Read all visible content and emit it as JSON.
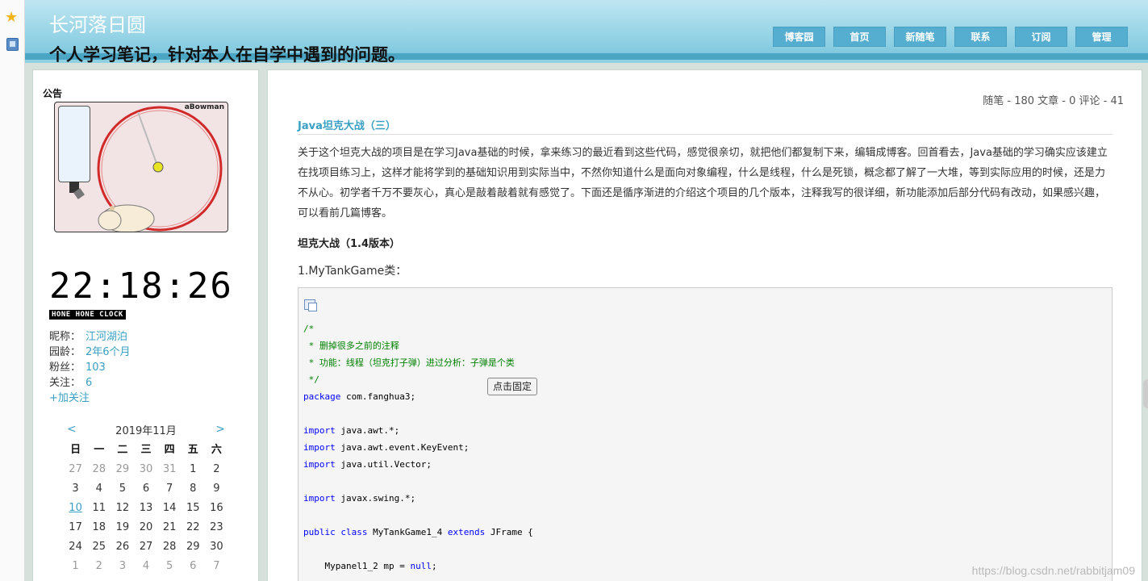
{
  "header": {
    "title": "长河落日圆",
    "subtitle": "个人学习笔记，针对本人在自学中遇到的问题。",
    "nav": [
      "博客园",
      "首页",
      "新随笔",
      "联系",
      "订阅",
      "管理"
    ]
  },
  "sidebar": {
    "notice_title": "公告",
    "hamster_brand": "aBowman",
    "clock_time": "22:18:26",
    "clock_label": "HONE HONE CLOCK",
    "profile": {
      "nickname_label": "昵称：",
      "nickname": "江河湖泊",
      "age_label": "园龄：",
      "age": "2年6个月",
      "fans_label": "粉丝：",
      "fans": "103",
      "follow_label": "关注：",
      "follow": "6",
      "add_follow": "+加关注"
    },
    "calendar": {
      "prev": "<",
      "next": ">",
      "month": "2019年11月",
      "weekdays": [
        "日",
        "一",
        "二",
        "三",
        "四",
        "五",
        "六"
      ],
      "weeks": [
        [
          "27",
          "28",
          "29",
          "30",
          "31",
          "1",
          "2"
        ],
        [
          "3",
          "4",
          "5",
          "6",
          "7",
          "8",
          "9"
        ],
        [
          "10",
          "11",
          "12",
          "13",
          "14",
          "15",
          "16"
        ],
        [
          "17",
          "18",
          "19",
          "20",
          "21",
          "22",
          "23"
        ],
        [
          "24",
          "25",
          "26",
          "27",
          "28",
          "29",
          "30"
        ],
        [
          "1",
          "2",
          "3",
          "4",
          "5",
          "6",
          "7"
        ]
      ]
    }
  },
  "main": {
    "stats": "随笔 - 180  文章 - 0  评论 - 41",
    "post_title": "Java坦克大战（三）",
    "post_body": "关于这个坦克大战的项目是在学习Java基础的时候，拿来练习的最近看到这些代码，感觉很亲切，就把他们都复制下来，编辑成博客。回首看去，Java基础的学习确实应该建立在找项目练习上，这样才能将学到的基础知识用到实际当中，不然你知道什么是面向对象编程，什么是线程，什么是死锁，概念都了解了一大堆，等到实际应用的时候，还是力不从心。初学者千万不要灰心，真心是敲着敲着就有感觉了。下面还是循序渐进的介绍这个项目的几个版本，注释我写的很详细，新功能添加后部分代码有改动，如果感兴趣，可以看前几篇博客。",
    "sub_heading": "坦克大战（1.4版本）",
    "class_label": "1.MyTankGame类：",
    "fix_button": "点击固定",
    "code": {
      "c1": "/*",
      "c2": " * 删掉很多之前的注释",
      "c3": " * 功能：线程（坦克打子弹）进过分析：子弹是个类",
      "c4": " */",
      "kw_package": "package",
      "pkg": " com.fanghua3;",
      "kw_import": "import",
      "imp1": " java.awt.*;",
      "imp2": " java.awt.event.KeyEvent;",
      "imp3": " java.util.Vector;",
      "imp4": " javax.swing.*;",
      "kw_public": "public",
      "kw_class": "class",
      "cls": " MyTankGame1_4 ",
      "kw_extends": "extends",
      "cls_end": " JFrame {",
      "field": "    Mypanel1_2 mp = ",
      "kw_null": "null",
      "semicolon": ";"
    },
    "watermark": "https://blog.csdn.net/rabbitjam09"
  }
}
